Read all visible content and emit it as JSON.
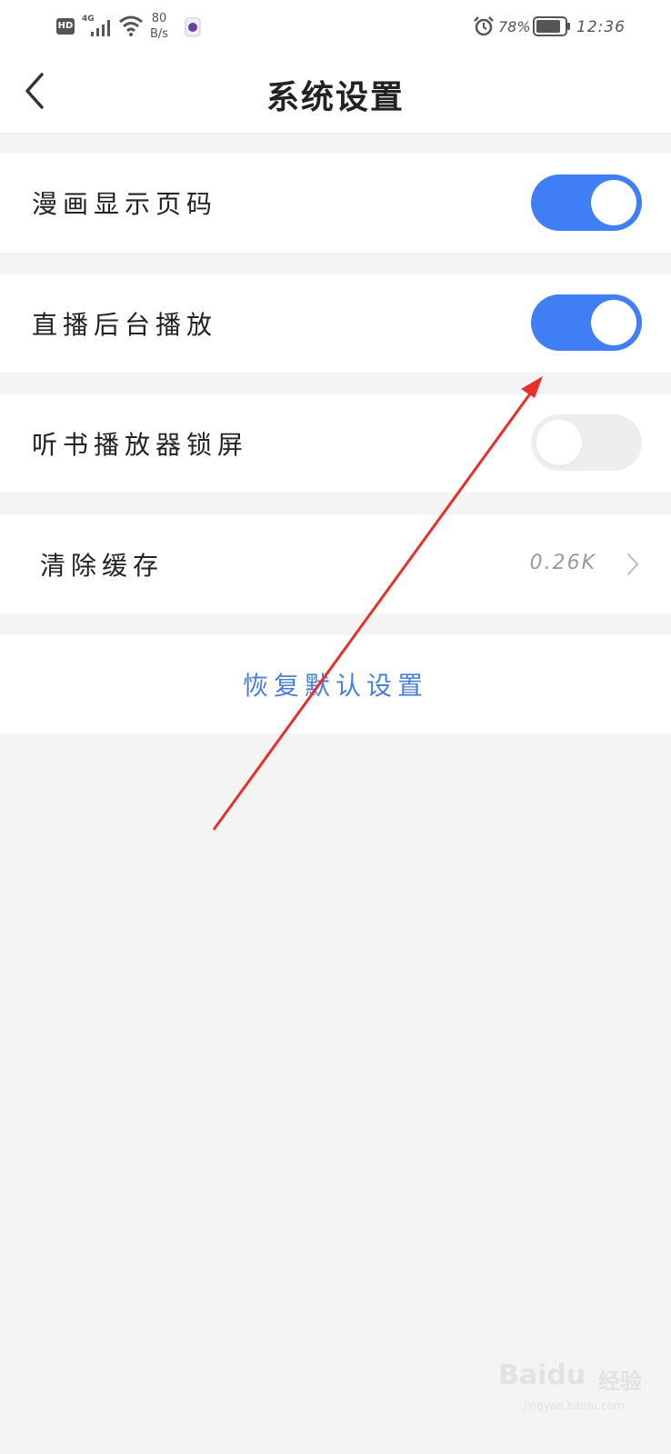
{
  "status_bar": {
    "hd": "HD",
    "network": "4G",
    "speed_value": "80",
    "speed_unit": "B/s",
    "battery_percent": "78%",
    "time": "12:36"
  },
  "header": {
    "title": "系统设置"
  },
  "settings": [
    {
      "label": "漫画显示页码",
      "type": "toggle",
      "on": true
    },
    {
      "label": "直播后台播放",
      "type": "toggle",
      "on": true
    },
    {
      "label": "听书播放器锁屏",
      "type": "toggle",
      "on": false
    }
  ],
  "cache": {
    "label": "清除缓存",
    "value": "0.26K"
  },
  "reset": {
    "label": "恢复默认设置"
  },
  "watermark": {
    "brand": "Baidu",
    "cn": "经验",
    "url": "jingyan.baidu.com"
  },
  "colors": {
    "accent": "#3f7ef5",
    "link": "#4a7fd6",
    "annotation_arrow": "#e8302a"
  }
}
